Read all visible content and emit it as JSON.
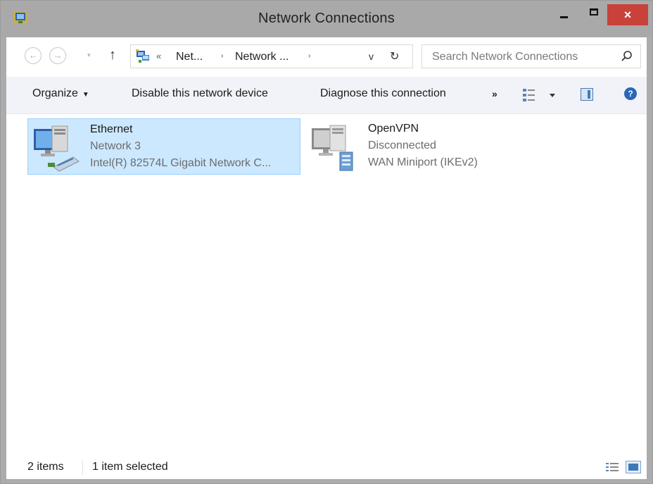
{
  "window": {
    "title": "Network Connections",
    "close_label": "×"
  },
  "navigation": {
    "back_glyph": "←",
    "forward_glyph": "→",
    "recent_glyph": "▾",
    "up_glyph": "↑",
    "breadcrumb_chevron": "«",
    "breadcrumbs": [
      "Net...",
      "Network ..."
    ],
    "separator_glyph": "›",
    "dropdown_glyph": "v",
    "refresh_glyph": "↻"
  },
  "search": {
    "placeholder": "Search Network Connections"
  },
  "toolbar": {
    "organize_label": "Organize",
    "organize_caret": "▼",
    "disable_label": "Disable this network device",
    "diagnose_label": "Diagnose this connection",
    "more_label": "»",
    "help_label": "?"
  },
  "connections": [
    {
      "name": "Ethernet",
      "status": "Network 3",
      "device": "Intel(R) 82574L Gigabit Network C...",
      "selected": true,
      "icon": "wired-network-adapter-icon"
    },
    {
      "name": "OpenVPN",
      "status": "Disconnected",
      "device": "WAN Miniport (IKEv2)",
      "selected": false,
      "icon": "vpn-connection-icon"
    }
  ],
  "statusbar": {
    "item_count": "2 items",
    "selection": "1 item selected"
  },
  "colors": {
    "titlebar": "#a9a9a9",
    "close_button": "#c8413b",
    "selection_fill": "#cce8ff",
    "selection_border": "#99d1ff",
    "command_bar": "#f1f3f8"
  }
}
